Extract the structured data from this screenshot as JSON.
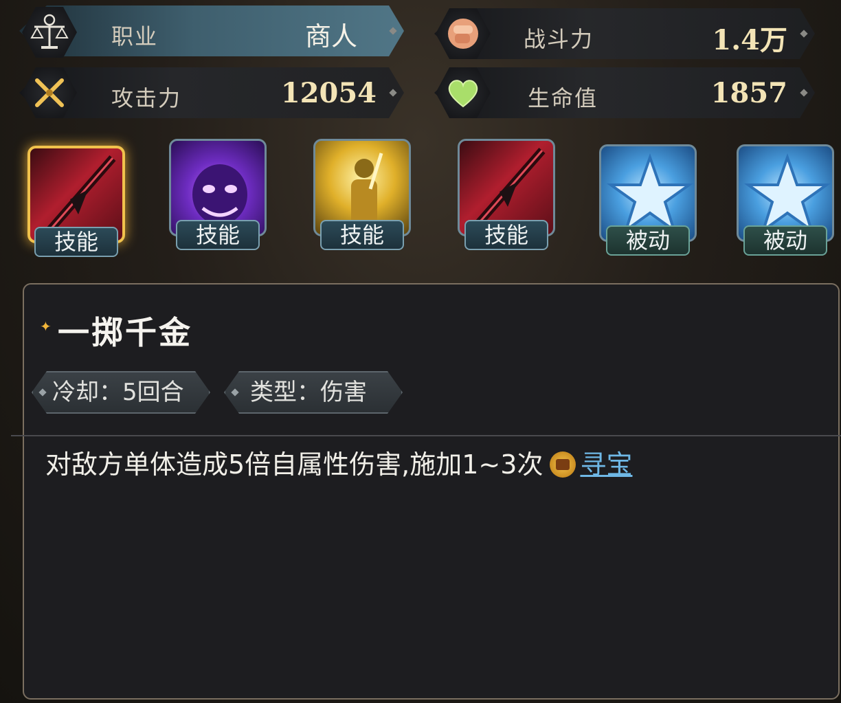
{
  "stats": {
    "profession": {
      "label": "职业",
      "value": "商人",
      "icon": "scales-icon"
    },
    "power": {
      "label": "战斗力",
      "value": "1.4万",
      "icon": "fist-icon"
    },
    "attack": {
      "label": "攻击力",
      "value": "12054",
      "icon": "crossed-swords-icon"
    },
    "hp": {
      "label": "生命值",
      "value": "1857",
      "icon": "heart-icon"
    }
  },
  "skills": [
    {
      "tag": "技能",
      "art": "red-spear",
      "selected": true
    },
    {
      "tag": "技能",
      "art": "purple-demon",
      "selected": false
    },
    {
      "tag": "技能",
      "art": "golden-knight",
      "selected": false
    },
    {
      "tag": "技能",
      "art": "red-spear",
      "selected": false
    },
    {
      "tag": "被动",
      "art": "blue-star",
      "selected": false
    },
    {
      "tag": "被动",
      "art": "blue-star",
      "selected": false
    }
  ],
  "detail": {
    "title": "一掷千金",
    "cooldown": "冷却：5回合",
    "type": "类型：伤害",
    "description": "对敌方单体造成5倍自属性伤害,施加1~3次",
    "link": "寻宝"
  },
  "colors": {
    "gold": "#f1c24c",
    "link": "#6fb8e6",
    "value": "#f3e4b6"
  }
}
